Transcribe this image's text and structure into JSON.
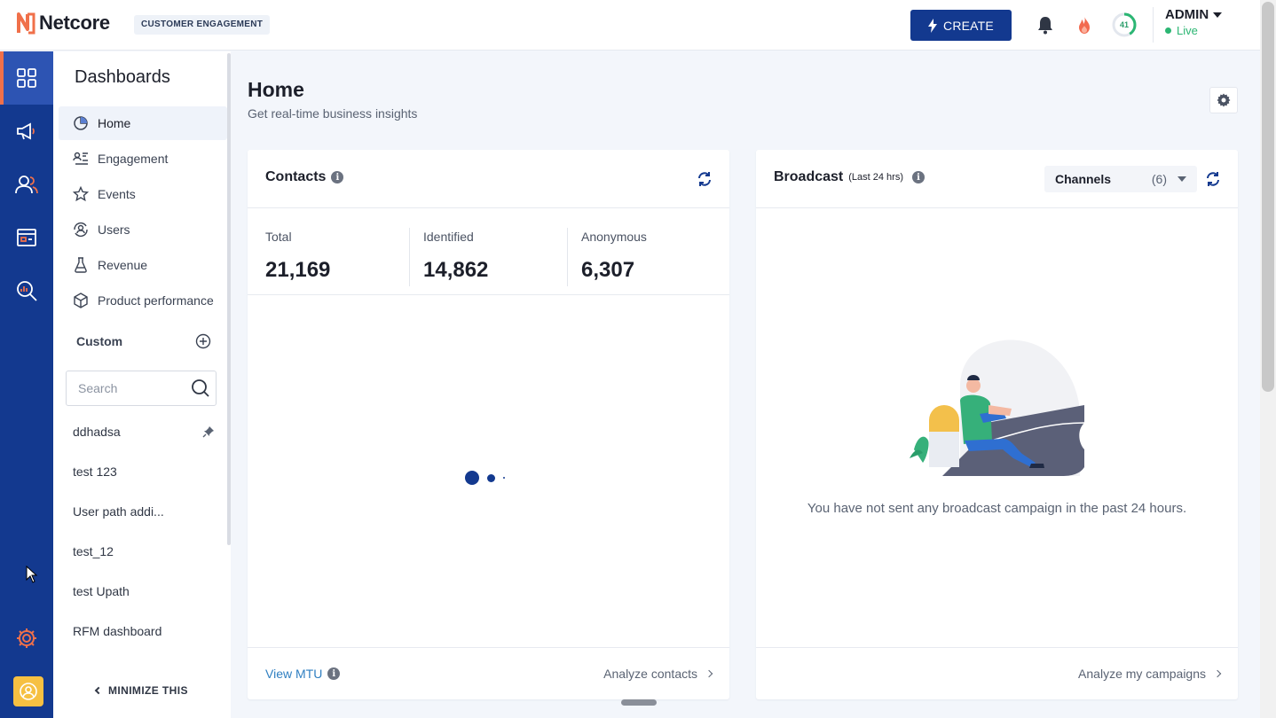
{
  "header": {
    "brand": "Netcore",
    "product_tag": "CUSTOMER ENGAGEMENT",
    "create_label": "CREATE",
    "progress_value": "41",
    "admin_name": "ADMIN",
    "admin_status": "Live"
  },
  "rail": {
    "icons": [
      "dashboard-grid-icon",
      "megaphone-icon",
      "users-icon",
      "campaign-board-icon",
      "analytics-search-icon",
      "settings-gear-icon",
      "avatar-icon"
    ],
    "active_color": "#2d54b3",
    "bg_color": "#13398f"
  },
  "sidebar": {
    "title": "Dashboards",
    "items": [
      {
        "label": "Home",
        "icon": "pie-chart-icon"
      },
      {
        "label": "Engagement",
        "icon": "engagement-icon"
      },
      {
        "label": "Events",
        "icon": "star-icon"
      },
      {
        "label": "Users",
        "icon": "users-cycle-icon"
      },
      {
        "label": "Revenue",
        "icon": "flask-icon"
      },
      {
        "label": "Product performance",
        "icon": "box-icon"
      }
    ],
    "custom_label": "Custom",
    "search_placeholder": "Search",
    "custom_items": [
      "ddhadsa",
      "test 123",
      "User path addi...",
      "test_12",
      "test Upath",
      "RFM dashboard"
    ],
    "minimize_label": "MINIMIZE THIS"
  },
  "main": {
    "title": "Home",
    "subtitle": "Get real-time business insights"
  },
  "contacts": {
    "title": "Contacts",
    "stats": [
      {
        "label": "Total",
        "value": "21,169"
      },
      {
        "label": "Identified",
        "value": "14,862"
      },
      {
        "label": "Anonymous",
        "value": "6,307"
      }
    ],
    "view_mtu": "View MTU",
    "analyze": "Analyze contacts"
  },
  "broadcast": {
    "title": "Broadcast",
    "period": "(Last 24 hrs)",
    "channels_label": "Channels",
    "channels_count": "(6)",
    "empty_message": "You have not sent any broadcast campaign in the past 24 hours.",
    "analyze": "Analyze my campaigns"
  },
  "colors": {
    "brand_orange": "#f0704a",
    "primary_blue": "#13398f",
    "link_blue": "#2f7fc1",
    "live_green": "#2bb673"
  }
}
